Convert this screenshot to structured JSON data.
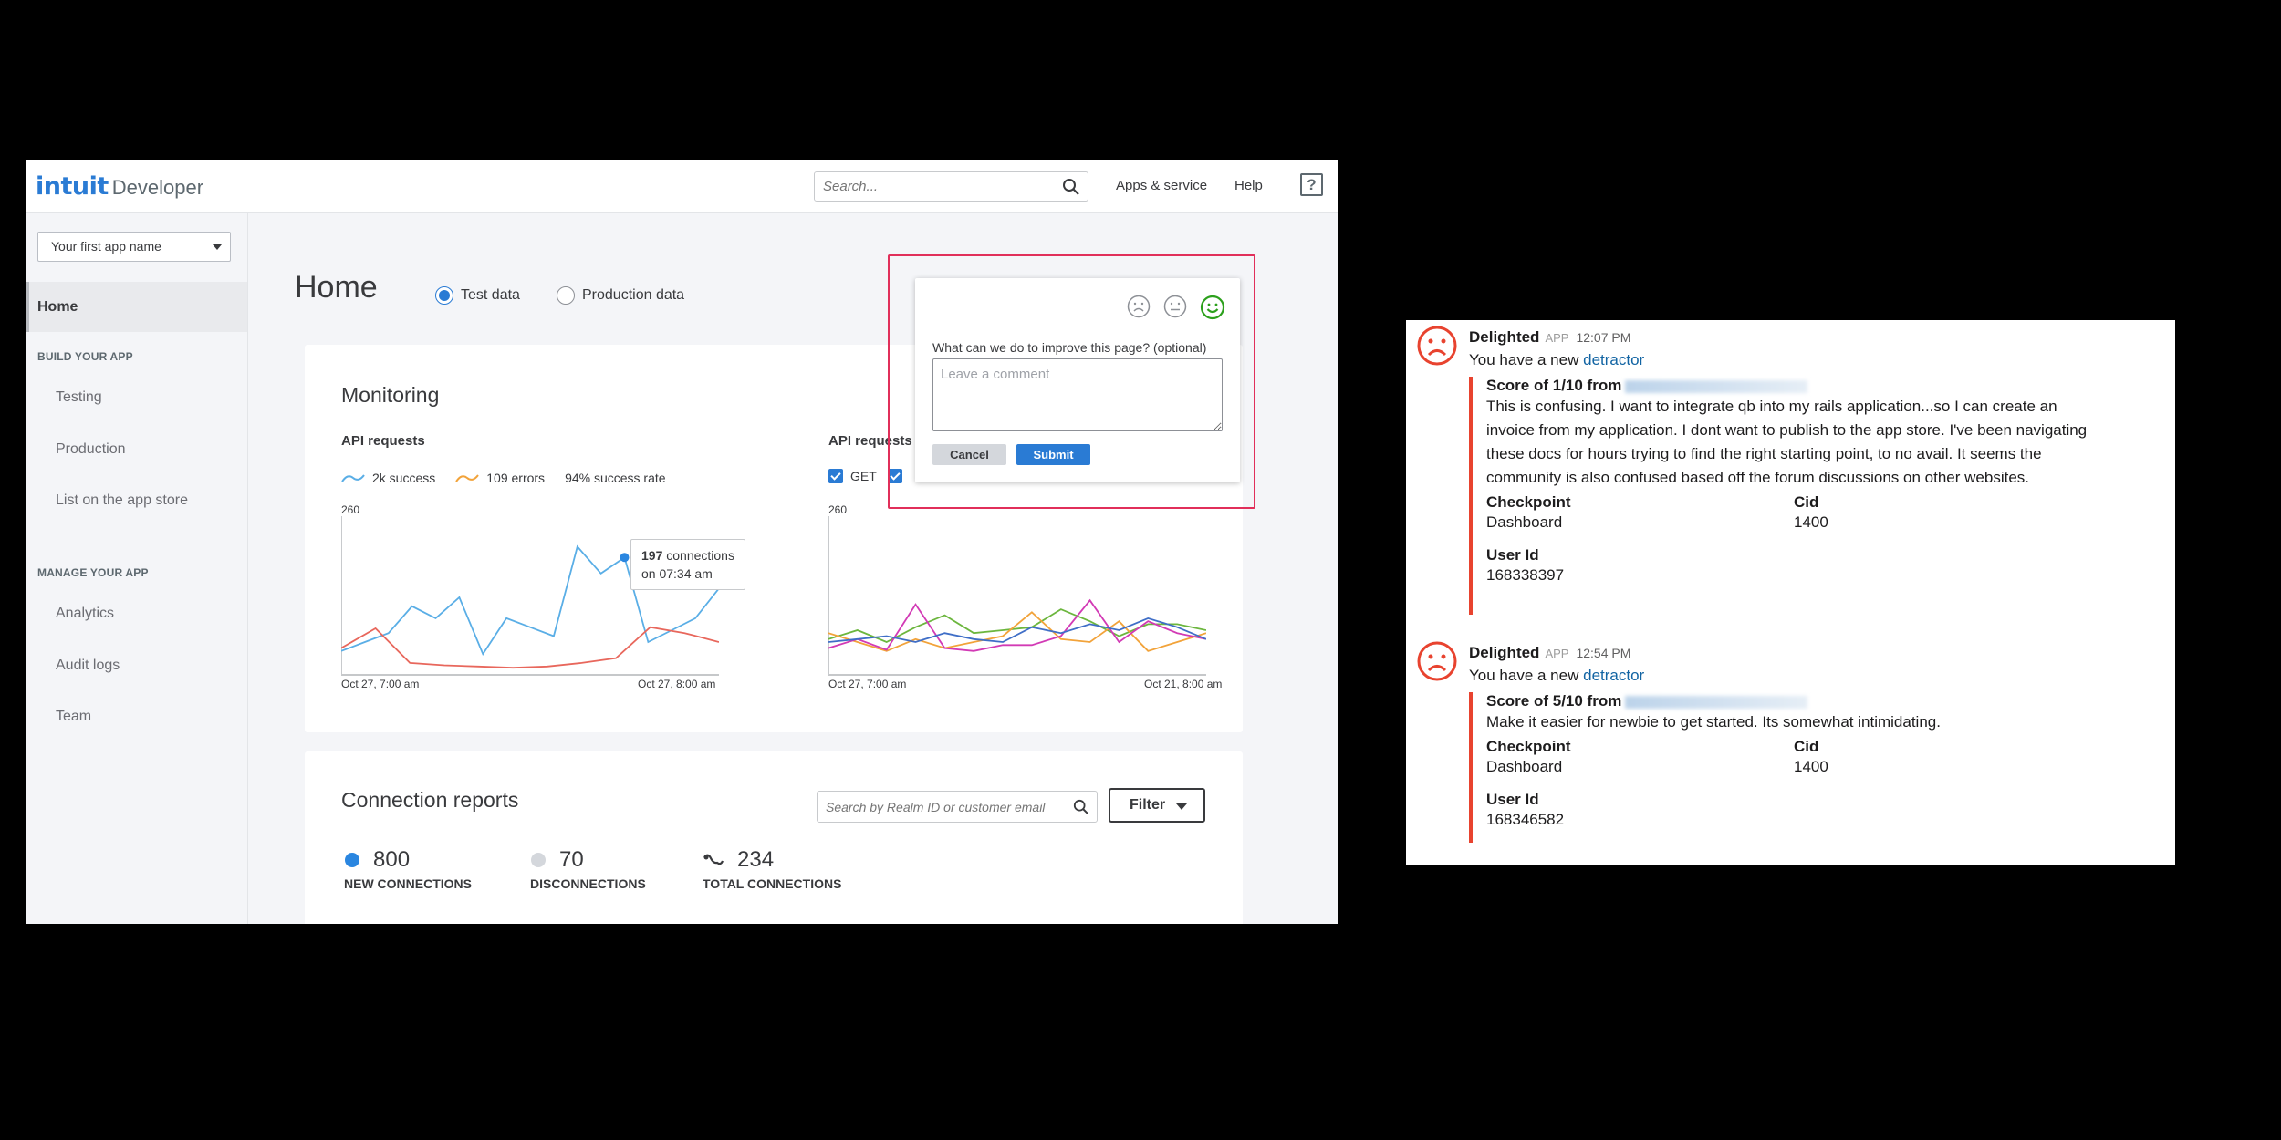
{
  "portal": {
    "logo_brand": "intuit",
    "logo_suffix": "Developer",
    "search_placeholder": "Search...",
    "nav_links": [
      "Apps & service",
      "Help"
    ],
    "help_glyph": "?",
    "icons": {
      "search": "search-icon",
      "help": "help-icon",
      "dropdown": "chevron-down-icon"
    }
  },
  "sidebar": {
    "app_select": "Your first app name",
    "home": "Home",
    "sections": [
      {
        "title": "BUILD YOUR APP",
        "items": [
          "Testing",
          "Production",
          "List on the app store"
        ]
      },
      {
        "title": "MANAGE YOUR APP",
        "items": [
          "Analytics",
          "Audit logs",
          "Team"
        ]
      }
    ]
  },
  "main": {
    "title": "Home",
    "data_modes": [
      {
        "label": "Test data",
        "selected": true
      },
      {
        "label": "Production data",
        "selected": false
      }
    ]
  },
  "monitoring": {
    "title": "Monitoring",
    "left_chart": {
      "title": "API requests",
      "legend": [
        "2k success",
        "109 errors",
        "94% success rate"
      ],
      "y_top": "260",
      "x_start": "Oct 27, 7:00 am",
      "x_end": "Oct 27, 8:00 am",
      "tooltip_value": "197",
      "tooltip_unit": "connections",
      "tooltip_time": "on 07:34 am"
    },
    "right_chart": {
      "title": "API requests",
      "legend": [
        "GET"
      ],
      "y_top": "260",
      "x_start": "Oct 27, 7:00 am",
      "x_end": "Oct 21, 8:00 am"
    }
  },
  "chart_data": [
    {
      "type": "line",
      "title": "API requests",
      "ylim": [
        0,
        260
      ],
      "x": [
        "Oct 27, 7:00 am",
        "Oct 27, 8:00 am"
      ],
      "series": [
        {
          "name": "2k success",
          "color": "#5aaee6",
          "values": [
            40,
            55,
            70,
            115,
            95,
            130,
            35,
            95,
            80,
            65,
            215,
            170,
            197,
            55,
            75,
            95,
            145
          ]
        },
        {
          "name": "109 errors",
          "color": "#e8675c",
          "values": [
            45,
            78,
            20,
            16,
            14,
            12,
            14,
            20,
            28,
            80,
            70,
            55
          ]
        }
      ],
      "annotation": {
        "value": 197,
        "label": "connections",
        "time": "07:34 am"
      }
    },
    {
      "type": "line",
      "title": "API requests",
      "ylim": [
        0,
        260
      ],
      "series": [
        {
          "name": "GET",
          "color": "#6cb63e",
          "values": [
            60,
            75,
            55,
            80,
            100,
            70,
            75,
            80,
            110,
            90,
            65,
            85,
            85,
            75
          ]
        },
        {
          "color": "#f2a33a",
          "values": [
            70,
            55,
            40,
            60,
            45,
            55,
            65,
            105,
            60,
            55,
            90,
            40,
            55,
            70
          ]
        },
        {
          "color": "#d23ab5",
          "values": [
            45,
            60,
            42,
            118,
            45,
            40,
            50,
            50,
            65,
            125,
            55,
            90,
            70,
            60
          ]
        },
        {
          "color": "#3f6ec7",
          "values": [
            55,
            60,
            65,
            55,
            70,
            60,
            55,
            80,
            70,
            85,
            75,
            95,
            80,
            60
          ]
        }
      ]
    }
  ],
  "connection_reports": {
    "title": "Connection reports",
    "search_placeholder": "Search by Realm ID or customer email",
    "filter_label": "Filter",
    "stats": [
      {
        "value": "800",
        "label": "NEW CONNECTIONS",
        "color": "#2a86e0"
      },
      {
        "value": "70",
        "label": "DISCONNECTIONS",
        "color": "#d4d7dc"
      },
      {
        "value": "234",
        "label": "TOTAL CONNECTIONS",
        "color": "#393a3d"
      }
    ]
  },
  "feedback_popup": {
    "question": "What can we do to improve this page? (optional)",
    "placeholder": "Leave a comment",
    "cancel": "Cancel",
    "submit": "Submit",
    "faces": [
      "sad-face-icon",
      "neutral-face-icon",
      "happy-face-icon"
    ],
    "selected_face_color": "#2ca01c",
    "frame_color": "#e12f5a"
  },
  "slack": {
    "messages": [
      {
        "sender": "Delighted",
        "badge": "APP",
        "time": "12:07 PM",
        "intro": "You have a new",
        "link": "detractor",
        "score": "Score of 1/10 from",
        "comment": "This is confusing. I want to integrate qb into my rails application...so I can create an invoice from my application. I dont want to publish to the app store. I've been navigating these docs for hours trying to find the right starting point, to no avail. It seems the community is also confused based off the forum discussions on other websites.",
        "checkpoint_label": "Checkpoint",
        "checkpoint": "Dashboard",
        "cid_label": "Cid",
        "cid": "1400",
        "userid_label": "User Id",
        "userid": "168338397"
      },
      {
        "sender": "Delighted",
        "badge": "APP",
        "time": "12:54 PM",
        "intro": "You have a new",
        "link": "detractor",
        "score": "Score of 5/10 from",
        "comment": "Make it easier for newbie to get started. Its somewhat intimidating.",
        "checkpoint_label": "Checkpoint",
        "checkpoint": "Dashboard",
        "cid_label": "Cid",
        "cid": "1400",
        "userid_label": "User Id",
        "userid": "168346582"
      }
    ],
    "accent_color": "#e8432f",
    "link_color": "#1264a3"
  }
}
